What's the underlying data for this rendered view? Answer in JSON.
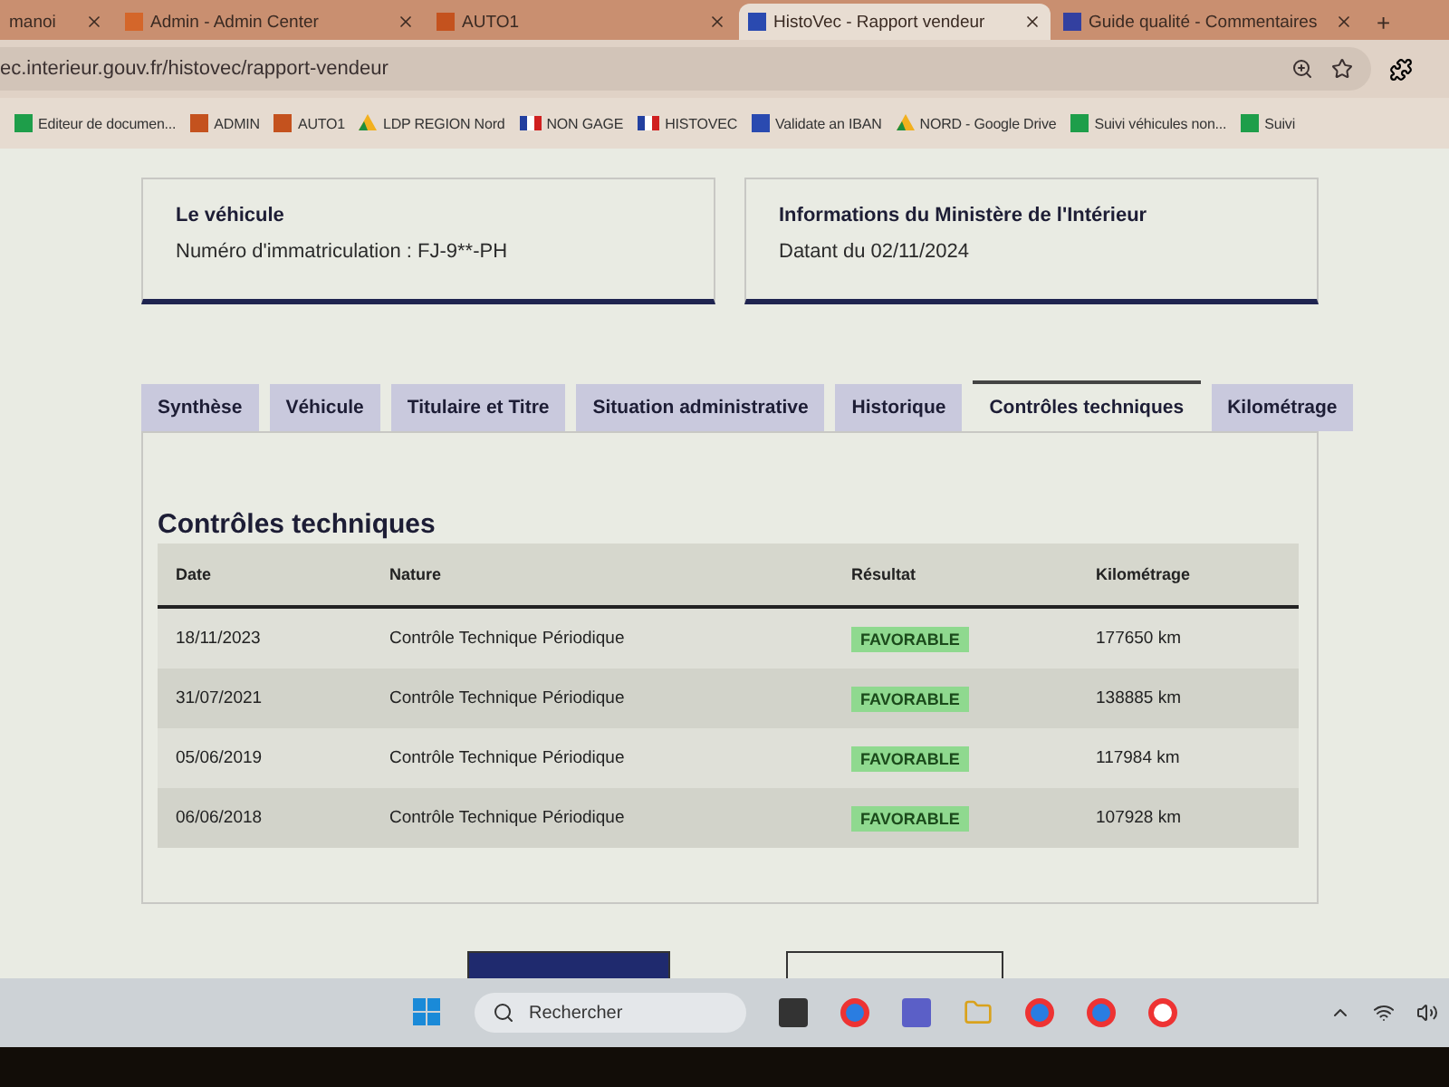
{
  "browser_tabs": [
    {
      "title": "manoi",
      "selected": false
    },
    {
      "title": "Admin - Admin Center",
      "selected": false
    },
    {
      "title": "AUTO1",
      "selected": false
    },
    {
      "title": "HistoVec - Rapport vendeur",
      "selected": true
    },
    {
      "title": "Guide qualité - Commentaires",
      "selected": false
    }
  ],
  "new_tab": "+",
  "address": "ec.interieur.gouv.fr/histovec/rapport-vendeur",
  "bookmarks": [
    {
      "label": "Editeur de documen...",
      "kind": "sheet"
    },
    {
      "label": "ADMIN",
      "kind": "square"
    },
    {
      "label": "AUTO1",
      "kind": "square"
    },
    {
      "label": "LDP REGION Nord",
      "kind": "drive"
    },
    {
      "label": "NON GAGE",
      "kind": "flag"
    },
    {
      "label": "HISTOVEC",
      "kind": "flag"
    },
    {
      "label": "Validate an IBAN",
      "kind": "bank"
    },
    {
      "label": "NORD - Google Drive",
      "kind": "drive"
    },
    {
      "label": "Suivi véhicules non...",
      "kind": "sheet"
    },
    {
      "label": "Suivi",
      "kind": "sheet"
    }
  ],
  "vehicle_card": {
    "title": "Le véhicule",
    "line": "Numéro d'immatriculation : FJ-9**-PH"
  },
  "ministry_card": {
    "title": "Informations du Ministère de l'Intérieur",
    "line": "Datant du 02/11/2024"
  },
  "tabs": [
    {
      "label": "Synthèse",
      "selected": false
    },
    {
      "label": "Véhicule",
      "selected": false
    },
    {
      "label": "Titulaire et Titre",
      "selected": false
    },
    {
      "label": "Situation administrative",
      "selected": false
    },
    {
      "label": "Historique",
      "selected": false
    },
    {
      "label": "Contrôles techniques",
      "selected": true
    },
    {
      "label": "Kilométrage",
      "selected": false
    }
  ],
  "section_title": "Contrôles techniques",
  "table": {
    "columns": [
      "Date",
      "Nature",
      "Résultat",
      "Kilométrage"
    ],
    "rows": [
      {
        "date": "18/11/2023",
        "nature": "Contrôle Technique Périodique",
        "result": "FAVORABLE",
        "km": "177650 km"
      },
      {
        "date": "31/07/2021",
        "nature": "Contrôle Technique Périodique",
        "result": "FAVORABLE",
        "km": "138885 km"
      },
      {
        "date": "05/06/2019",
        "nature": "Contrôle Technique Périodique",
        "result": "FAVORABLE",
        "km": "117984 km"
      },
      {
        "date": "06/06/2018",
        "nature": "Contrôle Technique Périodique",
        "result": "FAVORABLE",
        "km": "107928 km"
      }
    ]
  },
  "taskbar": {
    "search_placeholder": "Rechercher"
  }
}
